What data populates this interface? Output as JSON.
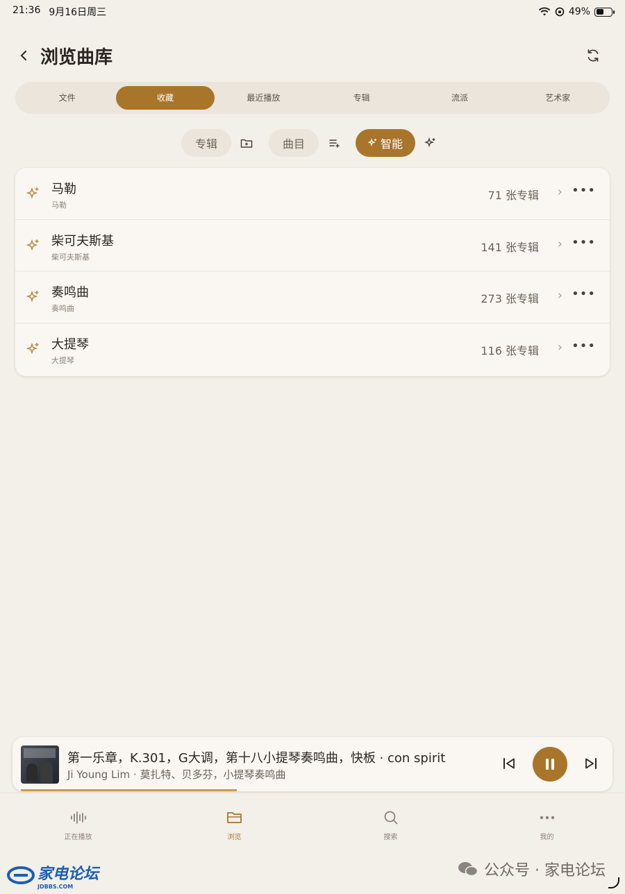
{
  "status": {
    "time": "21:36",
    "date": "9月16日周三",
    "battery": "49%"
  },
  "header": {
    "title": "浏览曲库"
  },
  "tabs": [
    "文件",
    "收藏",
    "最近播放",
    "专辑",
    "流派",
    "艺术家"
  ],
  "active_tab": 1,
  "filters": {
    "album": "专辑",
    "track": "曲目",
    "smart": "智能"
  },
  "items": [
    {
      "name": "马勒",
      "sub": "马勒",
      "count": "71 张专辑"
    },
    {
      "name": "柴可夫斯基",
      "sub": "柴可夫斯基",
      "count": "141 张专辑"
    },
    {
      "name": "奏鸣曲",
      "sub": "奏鸣曲",
      "count": "273 张专辑"
    },
    {
      "name": "大提琴",
      "sub": "大提琴",
      "count": "116 张专辑"
    }
  ],
  "player": {
    "title": "第一乐章，K.301，G大调，第十八小提琴奏鸣曲，快板 · con spirit",
    "subtitle": "Ji Young Lim · 莫扎特、贝多芬，小提琴奏鸣曲",
    "progress": 0.37
  },
  "nav": [
    {
      "label": "正在播放",
      "icon": "waveform-icon"
    },
    {
      "label": "浏览",
      "icon": "folder-icon"
    },
    {
      "label": "搜索",
      "icon": "search-icon"
    },
    {
      "label": "我的",
      "icon": "more-dots-icon"
    }
  ],
  "active_nav": 1,
  "watermark": {
    "left": "家电论坛",
    "left_sub": "JDBBS.COM",
    "right": "公众号 · 家电论坛"
  },
  "colors": {
    "accent": "#a8752b",
    "background": "#f3efe9"
  }
}
